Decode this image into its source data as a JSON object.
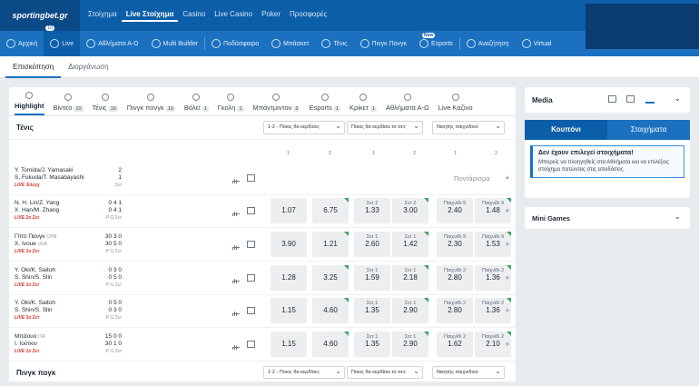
{
  "brand": "sportingbet.gr",
  "top_nav": [
    "Στοίχημα",
    "Live Στοίχημα",
    "Casino",
    "Live Casino",
    "Poker",
    "Προσφορές"
  ],
  "top_nav_active": 1,
  "sub_nav": [
    {
      "label": "Αρχική",
      "icon": "home-icon"
    },
    {
      "label": "Live",
      "icon": "live-icon",
      "badge": "10"
    },
    {
      "label": "Αθλήματα Α-Ω",
      "icon": "list-icon"
    },
    {
      "label": "Multi Builder",
      "icon": "builder-icon"
    },
    {
      "label": "Ποδόσφαιρο",
      "icon": "football-icon"
    },
    {
      "label": "Μπάσκετ",
      "icon": "basketball-icon"
    },
    {
      "label": "Τένις",
      "icon": "tennis-icon"
    },
    {
      "label": "Πινγκ Πονγκ",
      "icon": "pingpong-icon"
    },
    {
      "label": "Esports",
      "icon": "gamepad-icon",
      "badge": "New"
    },
    {
      "label": "Αναζήτηση",
      "icon": "search-icon"
    },
    {
      "label": "Virtual",
      "icon": "virtual-icon"
    }
  ],
  "page_tabs": [
    "Επισκόπηση",
    "Διοργάνωση"
  ],
  "sports": [
    {
      "label": "Highlight",
      "count": ""
    },
    {
      "label": "Βίντεο",
      "count": "10"
    },
    {
      "label": "Τένις",
      "count": "10"
    },
    {
      "label": "Πινγκ πονγκ",
      "count": "10"
    },
    {
      "label": "Βόλεϊ",
      "count": "1"
    },
    {
      "label": "Γκολη",
      "count": "1"
    },
    {
      "label": "Μπάντμιντον",
      "count": "3"
    },
    {
      "label": "Esports",
      "count": "1"
    },
    {
      "label": "Κρίκετ",
      "count": "1"
    },
    {
      "label": "Αθλήματα Α-Ω",
      "count": ""
    },
    {
      "label": "Live Καζίνο",
      "count": ""
    }
  ],
  "section": {
    "title": "Τένις",
    "dd1": "1-2 - Ποιος θα κερδίσει;",
    "dd2": "Ποιος θα κερδίσει το σετ;",
    "dd3": "Νικητής παιχνιδιού",
    "cols": [
      "1",
      "2",
      "1",
      "2",
      "1",
      "2"
    ]
  },
  "rows": [
    {
      "p1": "Y. Tomida/J. Yamasaki",
      "p2": "S. Fukuda/T. Masabayashi",
      "meta": "LIVE Έλεγχ",
      "s1": "2",
      "s2": "1",
      "smeta": "Σετ",
      "soon": "Ποντάρισμα"
    },
    {
      "p1": "N. H. Lin/Z. Yang",
      "p2": "X. Han/M. Zhang",
      "meta": "LIVE 2ο Σετ",
      "s1": "0 4 1",
      "s2": "0 4 1",
      "smeta": "P G Σετ",
      "o1": "1.07",
      "o2": "6.75",
      "m1": "Σετ 2",
      "m2": "Σετ 2",
      "o3": "1.33",
      "o4": "3.00",
      "m3": "Παιχνίδι 9",
      "m4": "Παιχνίδι 9",
      "o5": "2.40",
      "o6": "1.48"
    },
    {
      "p1": "Γίπτι Πανγκ",
      "p1tag": "CHN",
      "p2": "X. Ivoue",
      "p2tag": "USA",
      "meta": "LIVE 1ο Σετ",
      "s1": "30 3 0",
      "s2": "30 5 0",
      "smeta": "P G Σετ",
      "o1": "3.90",
      "o2": "1.21",
      "m1": "Σετ 1",
      "m2": "Σετ 1",
      "o3": "2.60",
      "o4": "1.42",
      "m3": "Παιχνίδι 9",
      "m4": "Παιχνίδι 9",
      "o5": "2.30",
      "o6": "1.53"
    },
    {
      "p1": "Y. Oki/K. Saitoh",
      "p2": "S. Shin/S. Slin",
      "meta": "LIVE 1ο Σετ",
      "s1": "0 3 0",
      "s2": "0 5 0",
      "smeta": "P G Σετ",
      "o1": "1.28",
      "o2": "3.25",
      "m1": "Σετ 1",
      "m2": "Σετ 1",
      "o3": "1.59",
      "o4": "2.18",
      "m3": "Παιχνίδι 2",
      "m4": "Παιχνίδι 2",
      "o5": "2.80",
      "o6": "1.36"
    },
    {
      "p1": "Y. Oki/K. Saitoh",
      "p2": "S. Shin/S. Slin",
      "meta": "LIVE 1ο Σετ",
      "s1": "0 5 0",
      "s2": "0 3 0",
      "smeta": "P G Σετ",
      "o1": "1.15",
      "o2": "4.60",
      "m1": "Σετ 1",
      "m2": "Σετ 1",
      "o3": "1.35",
      "o4": "2.90",
      "m3": "Παιχνίδι 2",
      "m4": "Παιχνίδι 2",
      "o5": "2.80",
      "o6": "1.36"
    },
    {
      "p1": "Μπάουο",
      "p1tag": "ITA",
      "p2": "Ι. Ιούτκιν",
      "p2tag": "",
      "meta": "LIVE 1ο Σετ",
      "s1": "15 0 0",
      "s2": "30 1 0",
      "smeta": "P G Σετ",
      "o1": "1.15",
      "o2": "4.60",
      "m1": "Σετ 1",
      "m2": "Σετ 1",
      "o3": "1.35",
      "o4": "2.90",
      "m3": "Παιχνίδι 2",
      "m4": "Παιχνίδι 2",
      "o5": "1.62",
      "o6": "2.10"
    }
  ],
  "section2": {
    "title": "Πινγκ πογκ",
    "dd1": "1-2 - Ποιος θα κερδίσει;",
    "dd2": "Ποιος θα κερδίσει το σετ;",
    "dd3": "Νικητής παιχνιδιού"
  },
  "media": {
    "title": "Media"
  },
  "coupon": {
    "tab1": "Κουπόνι",
    "tab2": "Στοιχήματα",
    "empty_title": "Δεν έχουν επιλεγεί στοιχήματα!",
    "empty_text": "Μπορείς να πλοηγηθείς στα Αθλήματα και να επιλέξεις στοίχημα πατώντας στις αποδόσεις"
  },
  "mini_games": {
    "title": "Mini Games"
  },
  "colors": {
    "brand_blue": "#0b5ea8",
    "live_red": "#d6312f",
    "odds_bg": "#eceef0",
    "up_green": "#3ca55c"
  }
}
